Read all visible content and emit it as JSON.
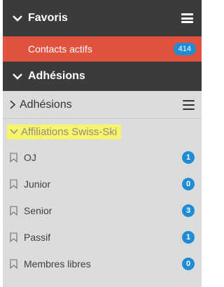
{
  "favoris": {
    "title": "Favoris",
    "active_item": {
      "label": "Contacts actifs",
      "count": "414"
    }
  },
  "adhesions_section": {
    "title": "Adhésions"
  },
  "adhesions_sub": {
    "title": "Adhésions"
  },
  "affiliations": {
    "title": "Affiliations Swiss-Ski",
    "items": [
      {
        "label": "OJ",
        "count": "1"
      },
      {
        "label": "Junior",
        "count": "0"
      },
      {
        "label": "Senior",
        "count": "3"
      },
      {
        "label": "Passif",
        "count": "1"
      },
      {
        "label": "Membres libres",
        "count": "0"
      }
    ]
  },
  "colors": {
    "dark_header": "#3b3b3b",
    "active_row": "#e2533f",
    "badge": "#1f8dd6",
    "highlight": "#f7f66a",
    "panel_bg": "#dcdcdc"
  },
  "icons": {
    "section_toggle": "chevron-down-icon",
    "sub_toggle": "chevron-right-icon",
    "menu": "hamburger-menu-icon",
    "item": "bookmark-icon"
  }
}
